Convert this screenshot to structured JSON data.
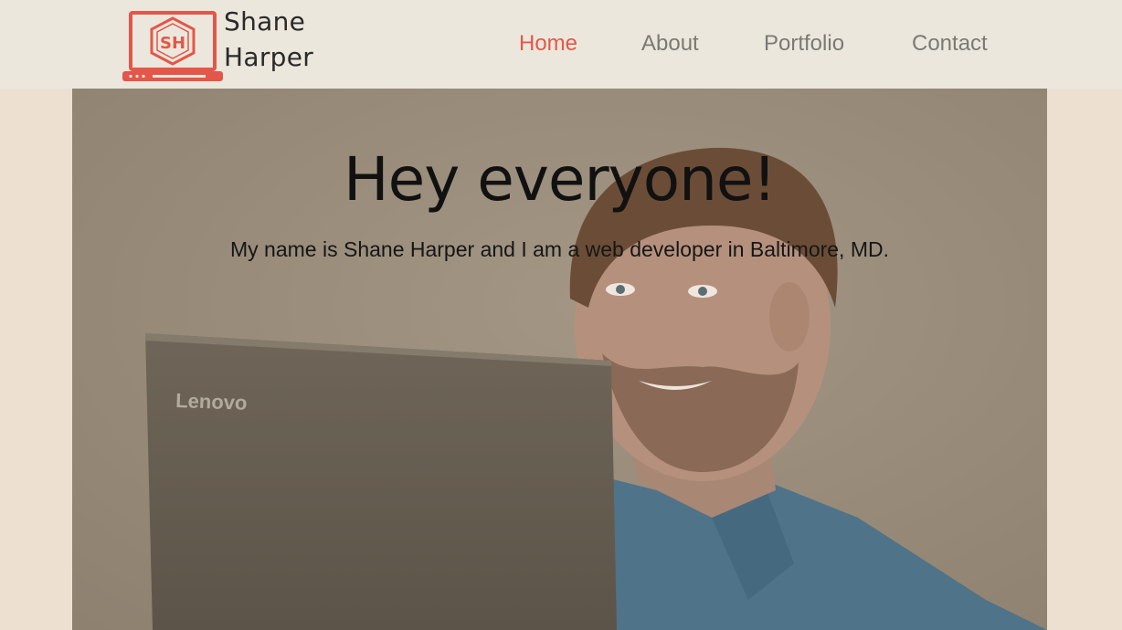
{
  "header": {
    "logo_first": "Shane",
    "logo_last": "Harper",
    "logo_monogram": "SH",
    "accent_color": "#e3574a"
  },
  "nav": {
    "items": [
      {
        "label": "Home",
        "active": true
      },
      {
        "label": "About",
        "active": false
      },
      {
        "label": "Portfolio",
        "active": false
      },
      {
        "label": "Contact",
        "active": false
      }
    ]
  },
  "hero": {
    "title": "Hey everyone!",
    "subtitle": "My name is Shane Harper and I am a web developer in Baltimore, MD.",
    "laptop_brand": "Lenovo"
  }
}
